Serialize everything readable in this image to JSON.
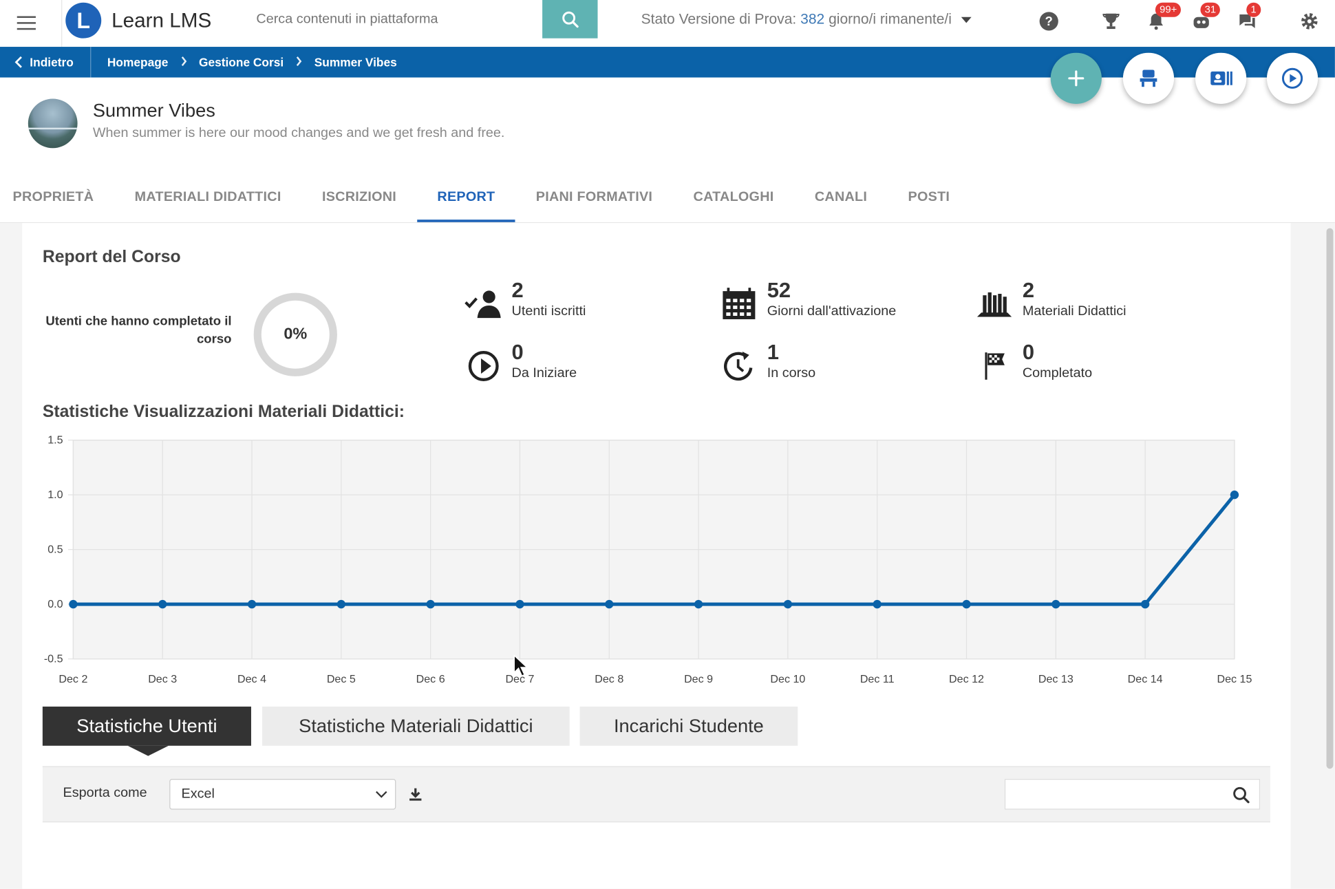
{
  "topbar": {
    "app_name": "Learn LMS",
    "logo_letter": "L",
    "search_placeholder": "Cerca contenuti in piattaforma",
    "trial_prefix": "Stato Versione di Prova:",
    "trial_days": "382",
    "trial_suffix": "giorno/i rimanente/i",
    "badges": {
      "notifications": "99+",
      "messages": "31",
      "chat": "1"
    },
    "icons": [
      "menu-icon",
      "search-icon",
      "help-icon",
      "trophy-icon",
      "bell-icon",
      "robot-icon",
      "chat-icon",
      "gear-icon"
    ]
  },
  "breadcrumb": {
    "back_label": "Indietro",
    "items": [
      "Homepage",
      "Gestione Corsi",
      "Summer Vibes"
    ]
  },
  "fabs": [
    "plus-icon",
    "classroom-icon",
    "id-card-icon",
    "play-icon"
  ],
  "course": {
    "title": "Summer Vibes",
    "description": "When summer is here our mood changes and we get fresh and free."
  },
  "tabs": [
    {
      "label": "PROPRIETÀ",
      "active": false
    },
    {
      "label": "MATERIALI DIDATTICI",
      "active": false
    },
    {
      "label": "ISCRIZIONI",
      "active": false
    },
    {
      "label": "REPORT",
      "active": true
    },
    {
      "label": "PIANI FORMATIVI",
      "active": false
    },
    {
      "label": "CATALOGHI",
      "active": false
    },
    {
      "label": "CANALI",
      "active": false
    },
    {
      "label": "POSTI",
      "active": false
    }
  ],
  "report": {
    "title": "Report del Corso",
    "completion_label": "Utenti che hanno completato il corso",
    "completion_percent": "0%",
    "stats": [
      {
        "value": "2",
        "label": "Utenti iscritti",
        "icon": "user-check-icon"
      },
      {
        "value": "52",
        "label": "Giorni dall'attivazione",
        "icon": "calendar-icon"
      },
      {
        "value": "2",
        "label": "Materiali Didattici",
        "icon": "library-icon"
      },
      {
        "value": "0",
        "label": "Da Iniziare",
        "icon": "play-circle-icon"
      },
      {
        "value": "1",
        "label": "In corso",
        "icon": "clock-progress-icon"
      },
      {
        "value": "0",
        "label": "Completato",
        "icon": "flag-icon"
      }
    ],
    "chart_title": "Statistiche Visualizzazioni Materiali Didattici:"
  },
  "chart_data": {
    "type": "line",
    "x": [
      "Dec 2",
      "Dec 3",
      "Dec 4",
      "Dec 5",
      "Dec 6",
      "Dec 7",
      "Dec 8",
      "Dec 9",
      "Dec 10",
      "Dec 11",
      "Dec 12",
      "Dec 13",
      "Dec 14",
      "Dec 15"
    ],
    "series": [
      {
        "values": [
          0,
          0,
          0,
          0,
          0,
          0,
          0,
          0,
          0,
          0,
          0,
          0,
          0,
          1
        ]
      }
    ],
    "ylim": [
      -0.5,
      1.5
    ],
    "yticks": [
      "1.5",
      "1.0",
      "0.5",
      "0.0",
      "-0.5"
    ],
    "grid": true,
    "line_color": "#0b62a8"
  },
  "lower_tabs": [
    {
      "label": "Statistiche Utenti",
      "active": true
    },
    {
      "label": "Statistiche Materiali Didattici",
      "active": false
    },
    {
      "label": "Incarichi Studente",
      "active": false
    }
  ],
  "export": {
    "label": "Esporta come",
    "selected": "Excel"
  },
  "colors": {
    "primary": "#0b62a8",
    "accent": "#5fb3b3",
    "badge": "#e53935"
  }
}
